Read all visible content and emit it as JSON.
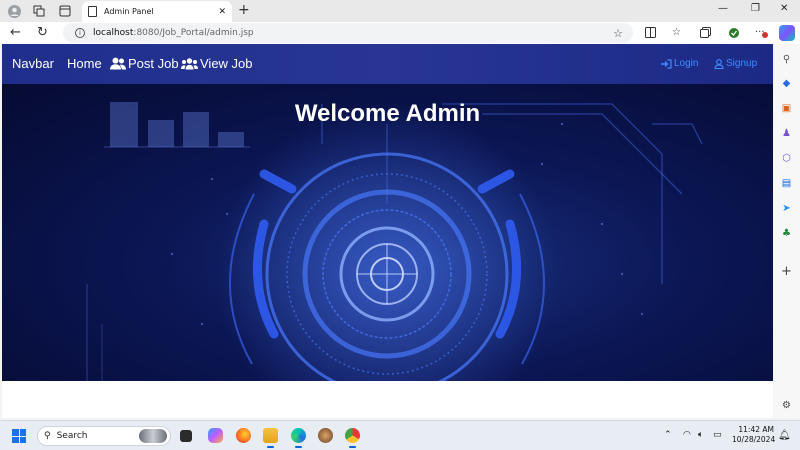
{
  "browser": {
    "tab_title": "Admin Panel",
    "new_tab_symbol": "+",
    "url_host": "localhost",
    "url_path": ":8080/Job_Portal/admin.jsp"
  },
  "navbar": {
    "brand": "Navbar",
    "links": [
      {
        "label": "Home",
        "icon": "none"
      },
      {
        "label": "Post Job",
        "icon": "users-icon"
      },
      {
        "label": "View Job",
        "icon": "user-group-icon"
      }
    ],
    "right_links": [
      {
        "label": "Login",
        "icon": "sign-in-icon"
      },
      {
        "label": "Signup",
        "icon": "user-icon"
      }
    ],
    "link_color": "#3f8bff",
    "bg_color": "#283593"
  },
  "hero": {
    "title": "Welcome Admin"
  },
  "taskbar": {
    "search_label": "Search",
    "time": "11:42 AM",
    "date": "10/28/2024"
  }
}
